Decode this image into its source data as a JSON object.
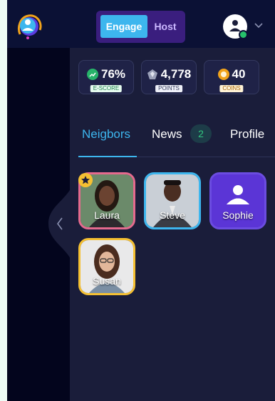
{
  "header": {
    "mode_toggle": {
      "active": "Engage",
      "inactive": "Host"
    },
    "icons": {
      "logo": "app-logo-icon",
      "avatar": "user-avatar-icon",
      "menu": "chevron-down-icon"
    }
  },
  "stats": [
    {
      "value": "76%",
      "label": "E-SCORE",
      "icon": "trend-up-icon",
      "color": "#27b36a"
    },
    {
      "value": "4,778",
      "label": "POINTS",
      "icon": "gem-icon",
      "color": "#9aa0b8"
    },
    {
      "value": "40",
      "label": "COINS",
      "icon": "coin-icon",
      "color": "#f2a31b"
    }
  ],
  "tabs": {
    "neighbors": "Neigbors",
    "news": "News",
    "news_count": "2",
    "profile": "Profile"
  },
  "neighbors": [
    {
      "name": "Laura",
      "border": "#e56a8e",
      "favorite": true
    },
    {
      "name": "Steve",
      "border": "#3db6ee",
      "favorite": false
    },
    {
      "name": "Sophie",
      "border": "#6b4ce0",
      "favorite": false
    },
    {
      "name": "Susan",
      "border": "#f5c032",
      "favorite": false
    }
  ],
  "colors": {
    "accent": "#3db6ee",
    "background": "#1a1d3a",
    "topbar": "#0b1135"
  }
}
